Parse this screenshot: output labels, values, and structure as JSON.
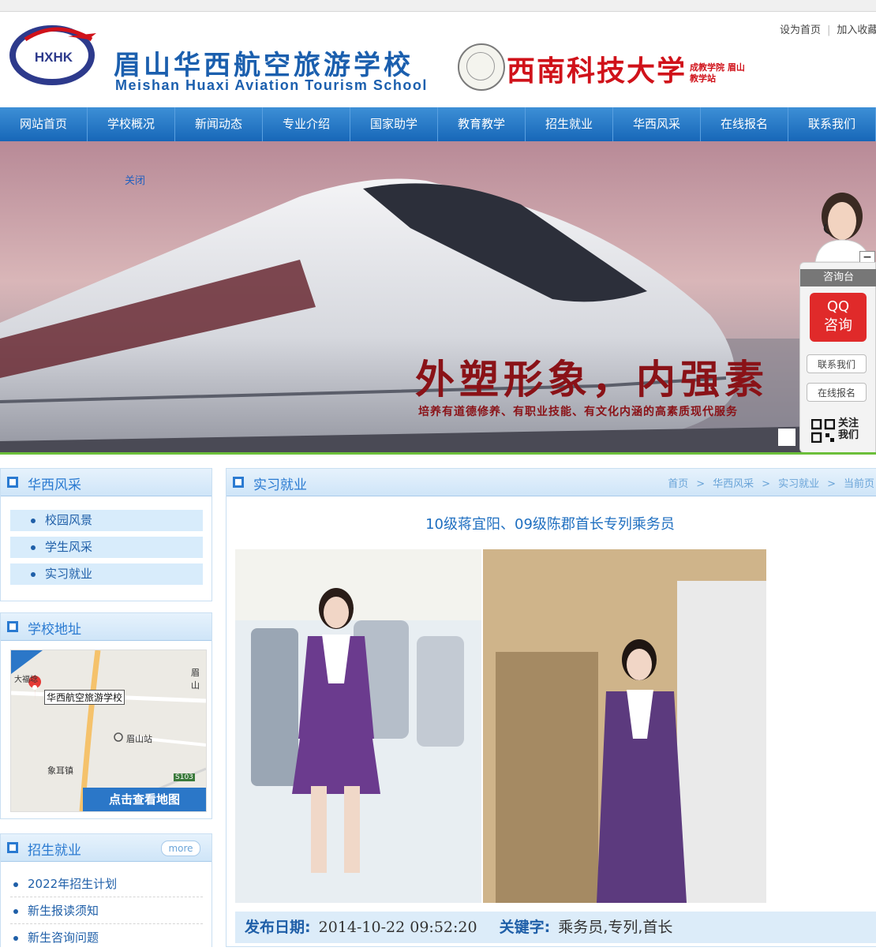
{
  "header": {
    "logo_text": "HXHK",
    "school_name_cn": "眉山华西航空旅游学校",
    "school_name_en": "Meishan Huaxi Aviation Tourism School",
    "university_name": "西南科技大学",
    "university_sub": "成教学院 眉山教学站",
    "links": [
      "设为首页",
      "加入收藏"
    ]
  },
  "nav": [
    "网站首页",
    "学校概况",
    "新闻动态",
    "专业介绍",
    "国家助学",
    "教育教学",
    "招生就业",
    "华西风采",
    "在线报名",
    "联系我们"
  ],
  "banner": {
    "close_label": "关闭",
    "slogan": "外塑形象，内强素",
    "subslogan": "培养有道德修养、有职业技能、有文化内涵的高素质现代服务"
  },
  "consult": {
    "title": "咨询台",
    "qq_line1": "QQ",
    "qq_line2": "咨询",
    "contact": "联系我们",
    "signup": "在线报名",
    "follow_line1": "关注",
    "follow_line2": "我们",
    "minimize": "−"
  },
  "sidebar": {
    "gallery": {
      "title": "华西风采",
      "items": [
        "校园风景",
        "学生风采",
        "实习就业"
      ]
    },
    "address": {
      "title": "学校地址",
      "map_labels": {
        "school": "华西航空旅游学校",
        "town1": "大福埝",
        "station": "眉山站",
        "town2": "象耳镇",
        "road": "S103",
        "edge": "眉山"
      },
      "map_button": "点击查看地图"
    },
    "enroll": {
      "title": "招生就业",
      "more": "more",
      "items": [
        "2022年招生计划",
        "新生报读须知",
        "新生咨询问题"
      ]
    }
  },
  "main": {
    "section_title": "实习就业",
    "breadcrumb": [
      "首页",
      "华西风采",
      "实习就业",
      "当前页"
    ],
    "article_title": "10级蒋宜阳、09级陈郡首长专列乘务员",
    "date_label": "发布日期:",
    "date_value": "2014-10-22 09:52:20",
    "keywords_label": "关键字:",
    "keywords_value": "乘务员,专列,首长"
  },
  "colors": {
    "nav_blue": "#1767b8",
    "link_blue": "#1f5fa8",
    "univ_red": "#d0121a",
    "qq_red": "#e02a2a"
  }
}
